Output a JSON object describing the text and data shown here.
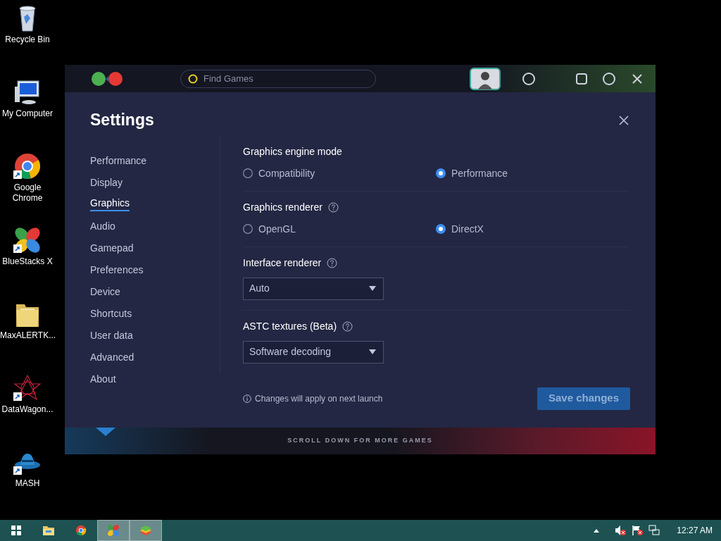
{
  "desktop_icons": [
    {
      "label": "Recycle Bin",
      "kind": "trash",
      "shortcut": false
    },
    {
      "label": "My Computer",
      "kind": "computer",
      "shortcut": false
    },
    {
      "label": "Google Chrome",
      "kind": "browser",
      "shortcut": true
    },
    {
      "label": "BlueStacks X",
      "kind": "launcher",
      "shortcut": true
    },
    {
      "label": "MaxALERTK...",
      "kind": "folder",
      "shortcut": false
    },
    {
      "label": "DataWagon...",
      "kind": "emblem",
      "shortcut": true
    },
    {
      "label": "MASH",
      "kind": "hat",
      "shortcut": true
    }
  ],
  "app": {
    "search": {
      "placeholder": "Find Games"
    },
    "banner": "SCROLL DOWN FOR MORE GAMES"
  },
  "settings": {
    "title": "Settings",
    "nav": [
      {
        "label": "Performance",
        "selected": false
      },
      {
        "label": "Display",
        "selected": false
      },
      {
        "label": "Graphics",
        "selected": true
      },
      {
        "label": "Audio",
        "selected": false
      },
      {
        "label": "Gamepad",
        "selected": false
      },
      {
        "label": "Preferences",
        "selected": false
      },
      {
        "label": "Device",
        "selected": false
      },
      {
        "label": "Shortcuts",
        "selected": false
      },
      {
        "label": "User data",
        "selected": false
      },
      {
        "label": "Advanced",
        "selected": false
      },
      {
        "label": "About",
        "selected": false
      }
    ],
    "sections": [
      {
        "title": "Graphics engine mode",
        "help": false,
        "kind": "radio",
        "options": [
          {
            "label": "Compatibility",
            "selected": false
          },
          {
            "label": "Performance",
            "selected": true
          }
        ]
      },
      {
        "title": "Graphics renderer",
        "help": true,
        "kind": "radio",
        "options": [
          {
            "label": "OpenGL",
            "selected": false
          },
          {
            "label": "DirectX",
            "selected": true
          }
        ]
      },
      {
        "title": "Interface renderer",
        "help": true,
        "kind": "select",
        "value": "Auto"
      },
      {
        "title": "ASTC textures (Beta)",
        "help": true,
        "kind": "select",
        "value": "Software decoding"
      }
    ],
    "note": "Changes will apply on next launch",
    "save_button": {
      "label": "Save changes",
      "disabled": true
    }
  },
  "taskbar": {
    "apps": [
      {
        "kind": "start",
        "active": false
      },
      {
        "kind": "explorer",
        "active": false
      },
      {
        "kind": "browser",
        "active": false
      },
      {
        "kind": "launcher",
        "active": true
      },
      {
        "kind": "stack",
        "active": true
      }
    ],
    "clock": "12:27 AM"
  }
}
